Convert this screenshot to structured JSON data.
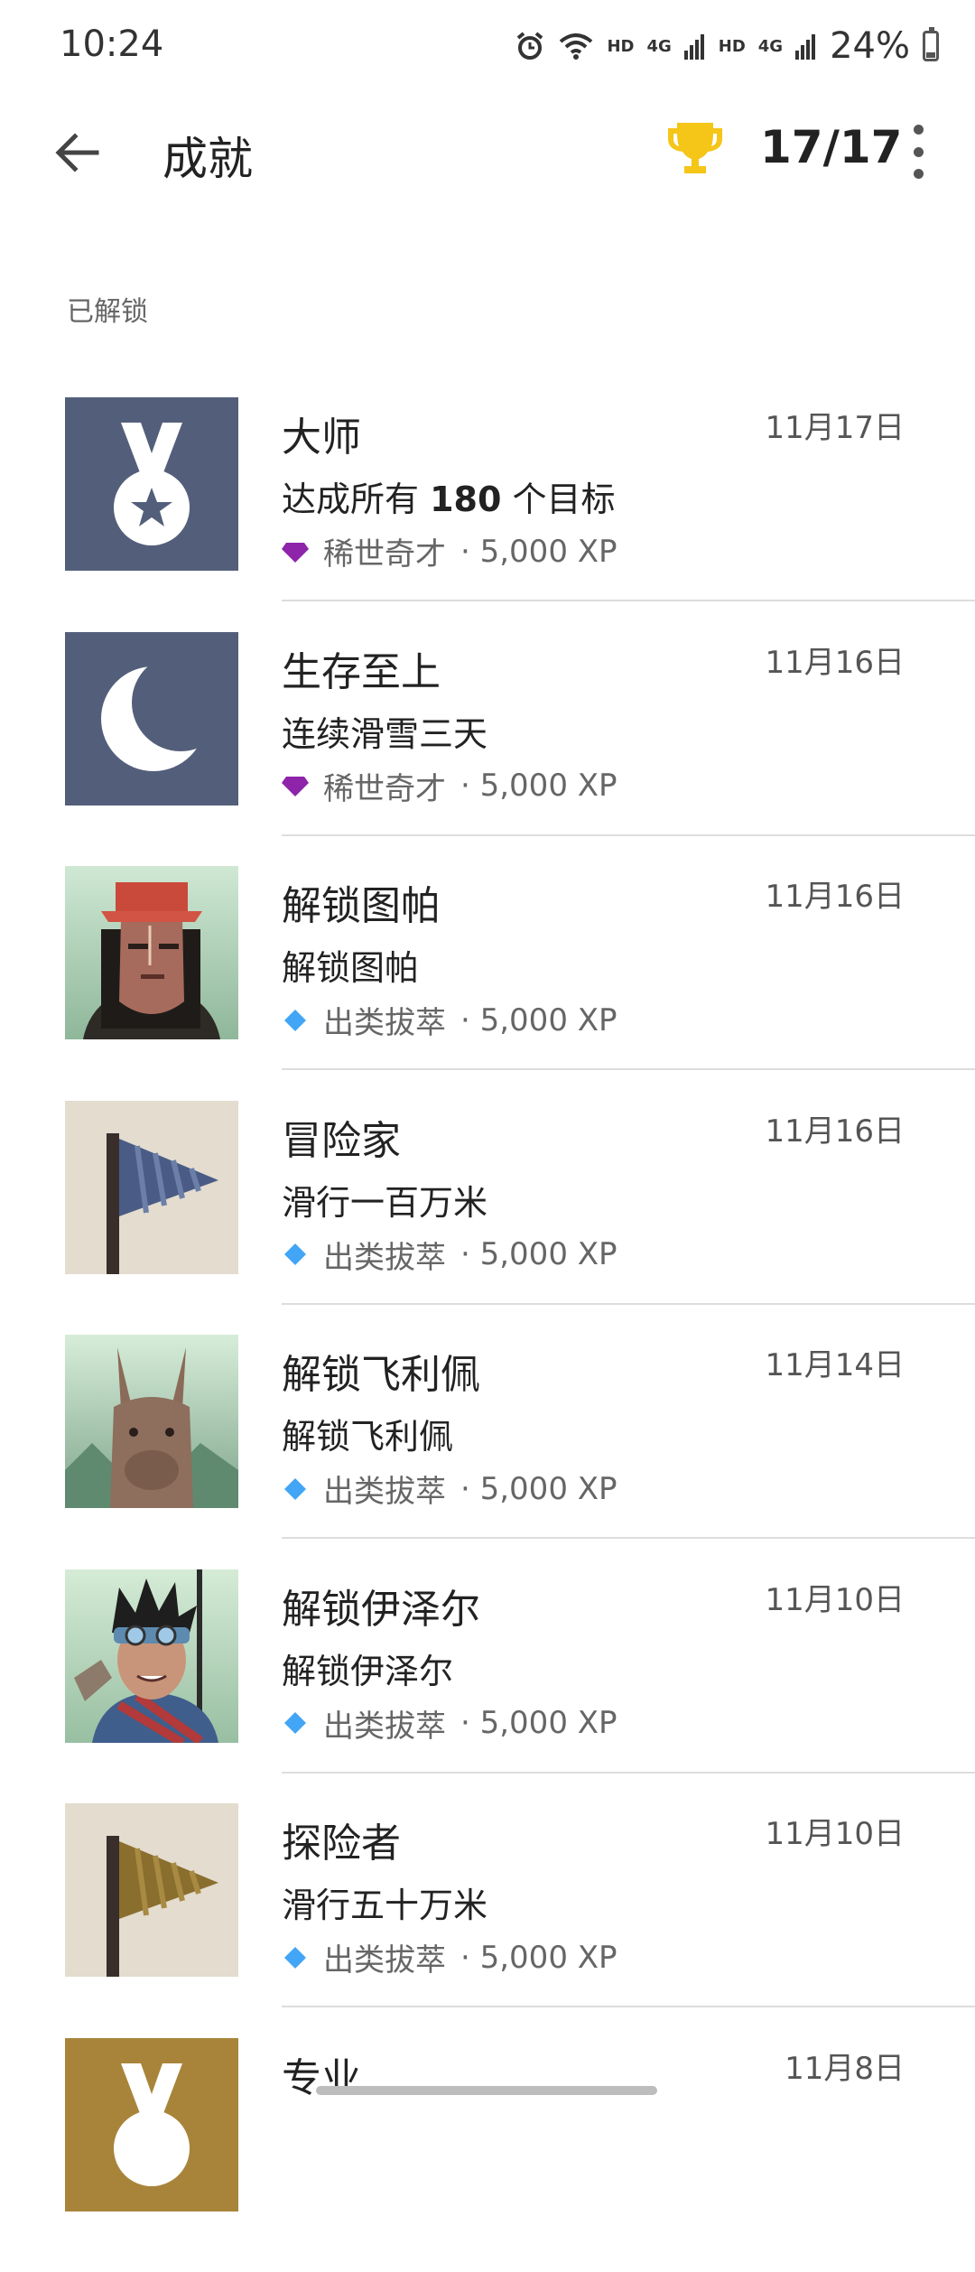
{
  "status": {
    "time": "10:24",
    "hd1": "HD",
    "net1": "4G",
    "hd2": "HD",
    "net2": "4G",
    "battery": "24%",
    "battery_level": 0.24
  },
  "appbar": {
    "title": "成就",
    "count": "17/17",
    "trophy_color": "#F5C518"
  },
  "section_label": "已解锁",
  "colors": {
    "rare_gem": "#8E24AA",
    "exceptional_gem": "#42A5F5"
  },
  "achievements": [
    {
      "title": "大师",
      "desc_prefix": "达成所有 ",
      "desc_bold": "180",
      "desc_suffix": " 个目标",
      "tier": "稀世奇才",
      "xp": "· 5,000 XP",
      "date": "11月17日",
      "icon": "medal-icon"
    },
    {
      "title": "生存至上",
      "desc": "连续滑雪三天",
      "tier": "稀世奇才",
      "xp": "· 5,000 XP",
      "date": "11月16日",
      "icon": "moon-icon"
    },
    {
      "title": "解锁图帕",
      "desc": "解锁图帕",
      "tier": "出类拔萃",
      "xp": "· 5,000 XP",
      "date": "11月16日",
      "icon": "character-tupa-icon"
    },
    {
      "title": "冒险家",
      "desc": "滑行一百万米",
      "tier": "出类拔萃",
      "xp": "· 5,000 XP",
      "date": "11月16日",
      "icon": "blue-flag-icon"
    },
    {
      "title": "解锁飞利佩",
      "desc": "解锁飞利佩",
      "tier": "出类拔萃",
      "xp": "· 5,000 XP",
      "date": "11月14日",
      "icon": "llama-icon"
    },
    {
      "title": "解锁伊泽尔",
      "desc": "解锁伊泽尔",
      "tier": "出类拔萃",
      "xp": "· 5,000 XP",
      "date": "11月10日",
      "icon": "character-izel-icon"
    },
    {
      "title": "探险者",
      "desc": "滑行五十万米",
      "tier": "出类拔萃",
      "xp": "· 5,000 XP",
      "date": "11月10日",
      "icon": "gold-flag-icon"
    },
    {
      "title": "专业",
      "date": "11月8日",
      "icon": "gold-medal-icon"
    }
  ]
}
